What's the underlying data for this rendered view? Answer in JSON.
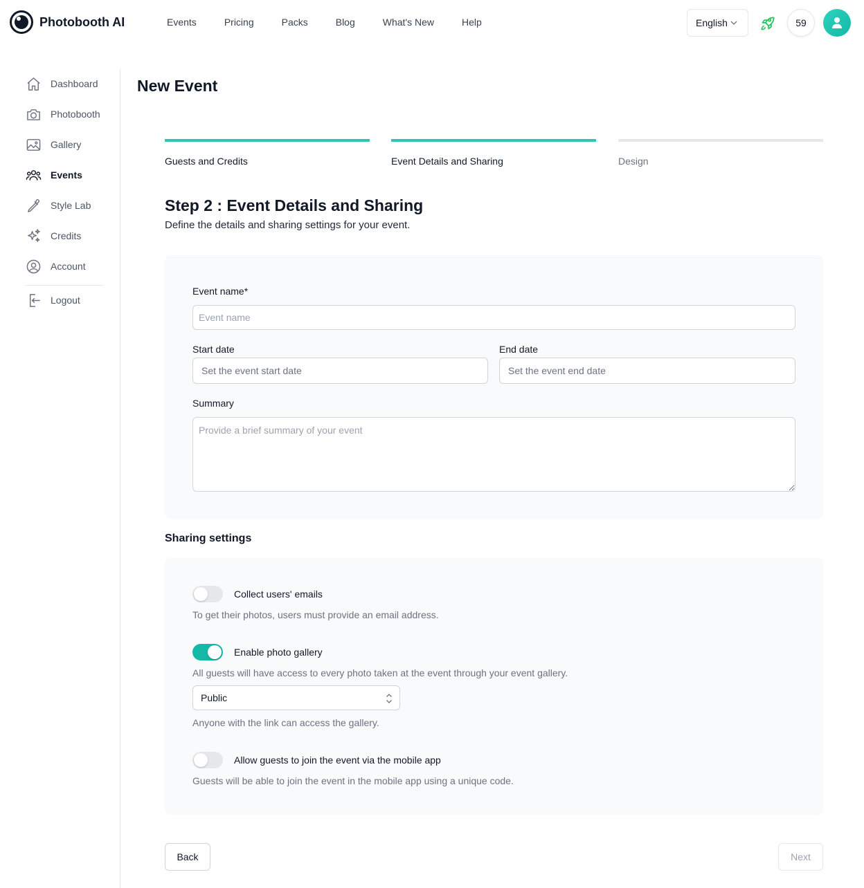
{
  "app": {
    "name": "Photobooth AI"
  },
  "topnav": {
    "links": [
      "Events",
      "Pricing",
      "Packs",
      "Blog",
      "What's New",
      "Help"
    ],
    "language": "English",
    "credits": "59"
  },
  "sidebar": {
    "items": [
      {
        "label": "Dashboard",
        "icon": "home-icon"
      },
      {
        "label": "Photobooth",
        "icon": "camera-icon"
      },
      {
        "label": "Gallery",
        "icon": "image-icon"
      },
      {
        "label": "Events",
        "icon": "users-icon",
        "active": true
      },
      {
        "label": "Style Lab",
        "icon": "eyedropper-icon"
      },
      {
        "label": "Credits",
        "icon": "sparkles-icon"
      },
      {
        "label": "Account",
        "icon": "user-circle-icon"
      }
    ],
    "logout": "Logout"
  },
  "page": {
    "title": "New Event"
  },
  "steps": [
    {
      "label": "Guests and Credits",
      "state": "done"
    },
    {
      "label": "Event Details and Sharing",
      "state": "current"
    },
    {
      "label": "Design",
      "state": "todo"
    }
  ],
  "step": {
    "title": "Step 2 : Event Details and Sharing",
    "description": "Define the details and sharing settings for your event."
  },
  "form": {
    "event_name_label": "Event name*",
    "event_name_placeholder": "Event name",
    "start_date_label": "Start date",
    "start_date_placeholder": "Set the event start date",
    "end_date_label": "End date",
    "end_date_placeholder": "Set the event end date",
    "summary_label": "Summary",
    "summary_placeholder": "Provide a brief summary of your event"
  },
  "sharing": {
    "heading": "Sharing settings",
    "collect_emails": {
      "label": "Collect users' emails",
      "help": "To get their photos, users must provide an email address.",
      "enabled": false
    },
    "photo_gallery": {
      "label": "Enable photo gallery",
      "help": "All guests will have access to every photo taken at the event through your event gallery.",
      "enabled": true
    },
    "gallery_visibility": {
      "value": "Public",
      "help": "Anyone with the link can access the gallery."
    },
    "mobile_app": {
      "label": "Allow guests to join the event via the mobile app",
      "help": "Guests will be able to join the event in the mobile app using a unique code.",
      "enabled": false
    }
  },
  "buttons": {
    "back": "Back",
    "next": "Next"
  },
  "colors": {
    "accent": "#14b8a6",
    "progress": "#2cc7b4",
    "rocket": "#22c55e"
  }
}
